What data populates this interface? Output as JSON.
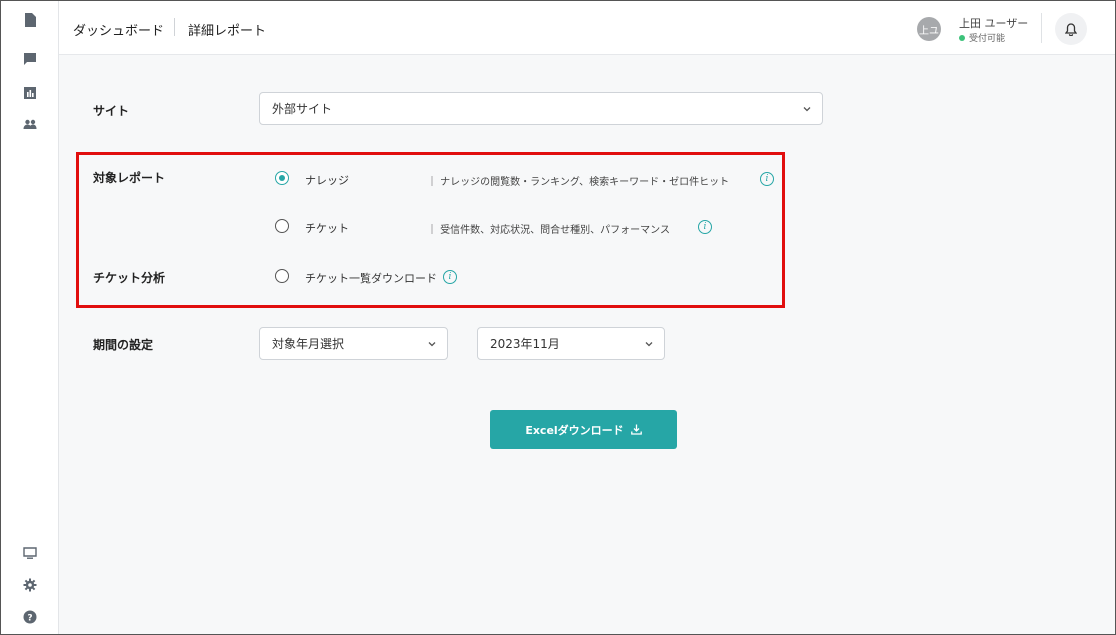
{
  "header": {
    "breadcrumb": [
      "ダッシュボード",
      "詳細レポート"
    ],
    "user": {
      "avatar_text": "上ユ",
      "name": "上田 ユーザー",
      "status": "受付可能"
    }
  },
  "form": {
    "site": {
      "label": "サイト",
      "value": "外部サイト"
    },
    "target_report": {
      "label": "対象レポート",
      "options": [
        {
          "label": "ナレッジ",
          "description": "｜ ナレッジの閲覧数・ランキング、検索キーワード・ゼロ件ヒット",
          "selected": true
        },
        {
          "label": "チケット",
          "description": "｜ 受信件数、対応状況、問合せ種別、パフォーマンス",
          "selected": false
        }
      ]
    },
    "ticket_analysis": {
      "label": "チケット分析",
      "option": {
        "label": "チケット一覧ダウンロード",
        "selected": false
      }
    },
    "period": {
      "label": "期間の設定",
      "type_value": "対象年月選択",
      "month_value": "2023年11月"
    },
    "download_button": "Excelダウンロード"
  },
  "colors": {
    "accent": "#26a6a6",
    "highlight_border": "#e10e0e"
  },
  "icons": {
    "sidebar_top": [
      "document-icon",
      "chat-icon",
      "chart-icon",
      "users-icon"
    ],
    "sidebar_bottom": [
      "monitor-icon",
      "gear-icon",
      "help-icon"
    ]
  }
}
